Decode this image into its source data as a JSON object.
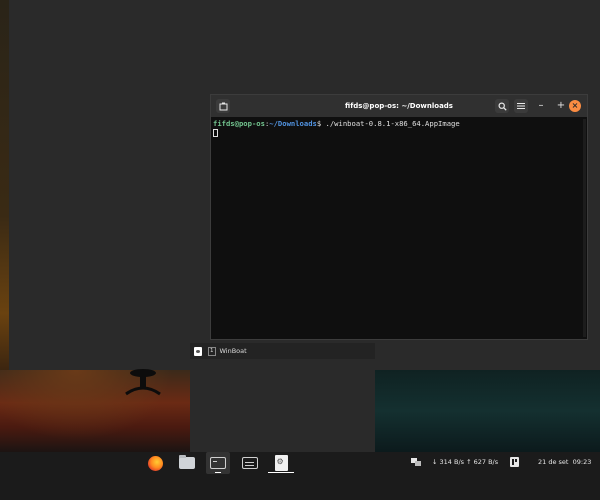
{
  "terminal": {
    "title": "fifds@pop-os: ~/Downloads",
    "prompt_user": "fifds@pop-os",
    "prompt_sep": ":",
    "prompt_path": "~/Downloads",
    "prompt_symbol": "$",
    "command": " ./winboat-0.8.1-x86_64.AppImage"
  },
  "dock_popup": {
    "workspace_num": "1",
    "label": "WinBoat"
  },
  "taskbar": {
    "apps": [
      {
        "name": "firefox-icon"
      },
      {
        "name": "files-icon"
      },
      {
        "name": "terminal-icon"
      },
      {
        "name": "system-monitor-icon"
      },
      {
        "name": "winboat-app-icon"
      }
    ],
    "network_text": "↓ 314 B/s ↑ 627 B/s",
    "date": "21 de set",
    "time": "09:23"
  },
  "colors": {
    "prompt_user": "#73c48f",
    "prompt_path": "#5294e2",
    "close_button": "#fb8c42",
    "taskbar": "#1b1b1b",
    "titlebar": "#303030"
  }
}
